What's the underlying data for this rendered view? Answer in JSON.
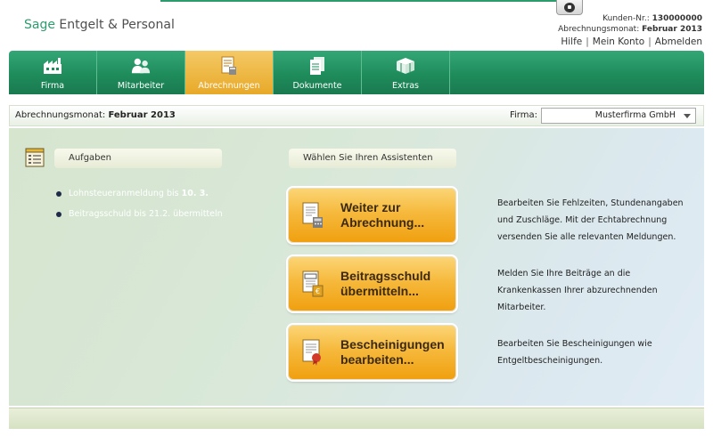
{
  "app": {
    "logo_brand": "Sage",
    "logo_product": "Entgelt & Personal"
  },
  "account": {
    "customer_label": "Kunden-Nr.:",
    "customer_number": "130000000",
    "month_label": "Abrechnungsmonat:",
    "month_value": "Februar 2013",
    "links": [
      "Hilfe",
      "Mein Konto",
      "Abmelden"
    ]
  },
  "nav": {
    "items": [
      {
        "label": "Firma",
        "icon": "factory-icon"
      },
      {
        "label": "Mitarbeiter",
        "icon": "people-icon"
      },
      {
        "label": "Abrechnungen",
        "icon": "calculator-document-icon",
        "active": true
      },
      {
        "label": "Dokumente",
        "icon": "documents-icon"
      },
      {
        "label": "Extras",
        "icon": "toolbox-icon"
      }
    ]
  },
  "filter": {
    "month_label": "Abrechnungsmonat:",
    "month_value": "Februar 2013",
    "firma_label": "Firma:",
    "firma_value": "Musterfirma GmbH"
  },
  "tasks": {
    "title": "Aufgaben",
    "icon": "task-list-icon",
    "items": [
      {
        "text": "Lohnsteueranmeldung bis",
        "highlight": "10. 3."
      },
      {
        "text": "Beitragsschuld bis 21.2. übermitteln",
        "highlight": ""
      }
    ]
  },
  "assistants": {
    "title": "Wählen Sie Ihren Assistenten",
    "buttons": [
      {
        "line1": "Weiter zur",
        "line2": "Abrechnung...",
        "icon": "calculator-document-icon",
        "description": "Bearbeiten Sie Fehlzeiten, Stundenangaben und Zuschläge. Mit der Echtabrechnung versenden Sie alle relevanten Meldungen."
      },
      {
        "line1": "Beitragsschuld",
        "line2": "übermitteln...",
        "icon": "svs-document-icon",
        "description": "Melden Sie Ihre Beiträge an die Krankenkassen Ihrer abzurechnenden Mitarbeiter."
      },
      {
        "line1": "Bescheinigungen",
        "line2": "bearbeiten...",
        "icon": "certificate-icon",
        "description": "Bearbeiten Sie Bescheinigungen wie Entgeltbescheinigungen."
      }
    ]
  },
  "colors": {
    "brand_green": "#2e9b6e",
    "active_orange": "#f0a010"
  }
}
